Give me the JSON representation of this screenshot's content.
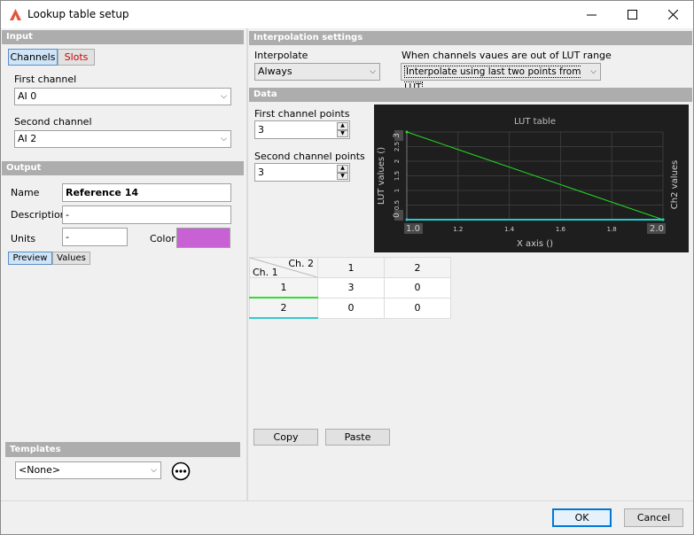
{
  "window": {
    "title": "Lookup table setup",
    "accent": "#e5533d"
  },
  "input": {
    "header": "Input",
    "tabs": [
      "Channels",
      "Slots"
    ],
    "first_channel_label": "First channel",
    "first_channel_value": "AI 0",
    "second_channel_label": "Second channel",
    "second_channel_value": "AI 2"
  },
  "output": {
    "header": "Output",
    "name_label": "Name",
    "name_value": "Reference 14",
    "description_label": "Description",
    "description_value": "-",
    "units_label": "Units",
    "units_value": "-",
    "color_label": "Color",
    "color_value": "#c862d4",
    "tabs": [
      "Preview",
      "Values"
    ]
  },
  "templates": {
    "header": "Templates",
    "value": "<None>"
  },
  "interpolation": {
    "header": "Interpolation settings",
    "interpolate_label": "Interpolate",
    "interpolate_value": "Always",
    "range_label": "When channels vaues are out of LUT range",
    "range_value": "Interpolate using last two points from LUT"
  },
  "data": {
    "header": "Data",
    "first_points_label": "First channel points",
    "first_points_value": "3",
    "second_points_label": "Second channel points",
    "second_points_value": "3",
    "table": {
      "corner_top": "Ch. 2",
      "corner_bottom": "Ch. 1",
      "col_headers": [
        "1",
        "2"
      ],
      "rows": [
        {
          "header": "1",
          "cells": [
            "3",
            "0"
          ],
          "color": "#33dd33"
        },
        {
          "header": "2",
          "cells": [
            "0",
            "0"
          ],
          "color": "#33cccc"
        }
      ]
    },
    "copy_label": "Copy",
    "paste_label": "Paste"
  },
  "chart_data": {
    "type": "line",
    "title": "LUT table",
    "xlabel": "X axis ()",
    "ylabel": "LUT values ()",
    "y2label": "Ch2 values",
    "xlim": [
      1.0,
      2.0
    ],
    "ylim": [
      0,
      3
    ],
    "x_ticks": [
      "1.0",
      "1.2",
      "1.4",
      "1.6",
      "1.8",
      "2.0"
    ],
    "y_ticks": [
      "0",
      "0.5",
      "1",
      "1.5",
      "2",
      "2.5",
      "3"
    ],
    "grid": true,
    "background": "#1e1e1e",
    "series": [
      {
        "x": [
          1.0,
          2.0
        ],
        "y": [
          3,
          0
        ],
        "color": "#22dd22"
      },
      {
        "x": [
          1.0,
          2.0
        ],
        "y": [
          0,
          0
        ],
        "color": "#22cccc"
      }
    ]
  },
  "footer": {
    "ok_label": "OK",
    "cancel_label": "Cancel"
  }
}
